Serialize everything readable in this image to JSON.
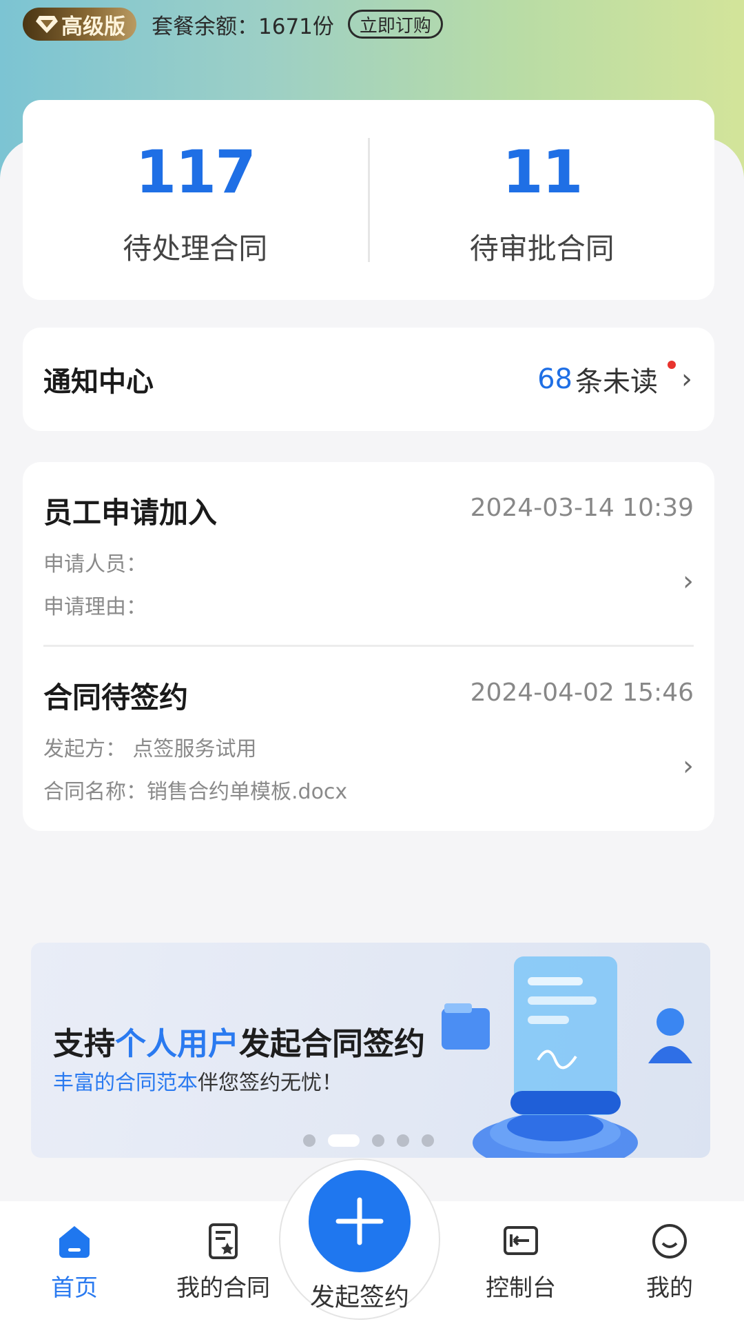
{
  "header": {
    "tier_label": "高级版",
    "quota_text": "套餐余额：1671份",
    "order_label": "立即订购"
  },
  "stats": [
    {
      "value": "117",
      "label": "待处理合同"
    },
    {
      "value": "11",
      "label": "待审批合同"
    }
  ],
  "notice": {
    "title": "通知中心",
    "count": "68",
    "suffix": "条未读"
  },
  "list": [
    {
      "title": "员工申请加入",
      "time": "2024-03-14 10:39",
      "lines": [
        "申请人员：",
        "申请理由："
      ]
    },
    {
      "title": "合同待签约",
      "time": "2024-04-02 15:46",
      "lines": [
        "发起方：  点签服务试用",
        "合同名称：销售合约单模板.docx"
      ]
    }
  ],
  "banner": {
    "title_pre": "支持",
    "title_hl": "个人用户",
    "title_post": "发起合同签约",
    "sub_hl": "丰富的合同范本",
    "sub_post": "伴您签约无忧！",
    "active_dot": 2,
    "dot_count": 5
  },
  "tabbar": {
    "tabs": [
      {
        "label": "首页",
        "icon": "home-icon"
      },
      {
        "label": "我的合同",
        "icon": "contract-icon"
      },
      {
        "label": "发起签约",
        "icon": "plus-icon"
      },
      {
        "label": "控制台",
        "icon": "console-icon"
      },
      {
        "label": "我的",
        "icon": "profile-icon"
      }
    ],
    "active": 0
  },
  "colors": {
    "accent": "#1f77ef",
    "unread_dot": "#e8342e"
  }
}
